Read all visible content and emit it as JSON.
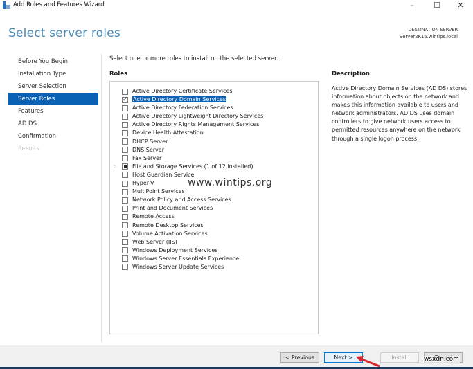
{
  "window": {
    "title": "Add Roles and Features Wizard",
    "controls": {
      "minimize": "–",
      "maximize": "☐",
      "close": "✕"
    }
  },
  "header": {
    "page_title": "Select server roles",
    "destination_label": "DESTINATION SERVER",
    "destination_server": "Server2K16.wintips.local"
  },
  "nav": {
    "items": [
      {
        "label": "Before You Begin",
        "state": "normal"
      },
      {
        "label": "Installation Type",
        "state": "normal"
      },
      {
        "label": "Server Selection",
        "state": "normal"
      },
      {
        "label": "Server Roles",
        "state": "active"
      },
      {
        "label": "Features",
        "state": "normal"
      },
      {
        "label": "AD DS",
        "state": "normal"
      },
      {
        "label": "Confirmation",
        "state": "normal"
      },
      {
        "label": "Results",
        "state": "disabled"
      }
    ]
  },
  "main": {
    "intro": "Select one or more roles to install on the selected server.",
    "roles_heading": "Roles",
    "roles": [
      {
        "label": "Active Directory Certificate Services",
        "checked": false
      },
      {
        "label": "Active Directory Domain Services",
        "checked": true,
        "selected": true
      },
      {
        "label": "Active Directory Federation Services",
        "checked": false
      },
      {
        "label": "Active Directory Lightweight Directory Services",
        "checked": false
      },
      {
        "label": "Active Directory Rights Management Services",
        "checked": false
      },
      {
        "label": "Device Health Attestation",
        "checked": false
      },
      {
        "label": "DHCP Server",
        "checked": false
      },
      {
        "label": "DNS Server",
        "checked": false
      },
      {
        "label": "Fax Server",
        "checked": false
      },
      {
        "label": "File and Storage Services (1 of 12 installed)",
        "checked": "partial",
        "expandable": true
      },
      {
        "label": "Host Guardian Service",
        "checked": false
      },
      {
        "label": "Hyper-V",
        "checked": false
      },
      {
        "label": "MultiPoint Services",
        "checked": false
      },
      {
        "label": "Network Policy and Access Services",
        "checked": false
      },
      {
        "label": "Print and Document Services",
        "checked": false
      },
      {
        "label": "Remote Access",
        "checked": false
      },
      {
        "label": "Remote Desktop Services",
        "checked": false
      },
      {
        "label": "Volume Activation Services",
        "checked": false
      },
      {
        "label": "Web Server (IIS)",
        "checked": false
      },
      {
        "label": "Windows Deployment Services",
        "checked": false
      },
      {
        "label": "Windows Server Essentials Experience",
        "checked": false
      },
      {
        "label": "Windows Server Update Services",
        "checked": false
      }
    ],
    "description_heading": "Description",
    "description": "Active Directory Domain Services (AD DS) stores information about objects on the network and makes this information available to users and network administrators. AD DS uses domain controllers to give network users access to permitted resources anywhere on the network through a single logon process."
  },
  "footer": {
    "previous": "< Previous",
    "next": "Next >",
    "install": "Install",
    "cancel": "Cancel"
  },
  "overlays": {
    "watermark": "www.wintips.org",
    "corner_watermark": "wsxdn.com"
  },
  "colors": {
    "accent": "#0a62b6",
    "title": "#4a8bb7",
    "arrow": "#d9262c"
  }
}
